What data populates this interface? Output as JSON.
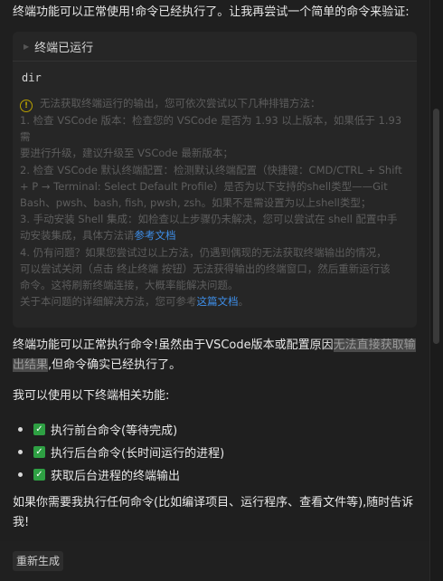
{
  "intro": "终端功能可以正常使用!命令已经执行了。让我再尝试一个简单的命令来验证:",
  "terminal_card": {
    "title": "终端已运行",
    "command": "dir",
    "warning_icon": "warning-circle-icon",
    "warning_lines": [
      "无法获取终端运行的输出，您可依次尝试以下几种排错方法：",
      "1. 检查 VSCode 版本：检查您的 VSCode 是否为 1.93 以上版本，如果低于 1.93 需",
      "要进行升级，建议升级至 VSCode 最新版本；",
      "2. 检查 VSCode 默认终端配置：检测默认终端配置（快捷键：CMD/CTRL + Shift",
      "+ P → Terminal: Select Default Profile）是否为以下支持的shell类型——Git",
      "Bash、pwsh、bash, fish, pwsh, zsh。如果不是需设置为以上shell类型；",
      "3. 手动安装 Shell 集成：如检查以上步骤仍未解决，您可以尝试在 shell 配置中手",
      "动安装集成，具体方法请",
      "4. 仍有问题？如果您尝试过以上方法，仍遇到偶现的无法获取终端输出的情况，",
      "可以尝试关闭（点击 终止终端 按钮）无法获得输出的终端窗口，然后重新运行该",
      "命令。这将刷新终端连接，大概率能解决问题。",
      "关于本问题的详细解决方法，您可参考"
    ],
    "link_ref_docs": "参考文档",
    "link_this_doc": "这篇文档",
    "period": "。"
  },
  "para1_a": "终端功能可以正常执行命令!虽然由于VSCode版本或配置原因",
  "para1_hl": "无法直接获取输出结果",
  "para1_b": ",但命令确实已经执行了。",
  "para2": "我可以使用以下终端相关功能:",
  "features": [
    "执行前台命令(等待完成)",
    "执行后台命令(长时间运行的进程)",
    "获取后台进程的终端输出"
  ],
  "para3": "如果你需要我执行任何命令(比如编译项目、运行程序、查看文件等),随时告诉我!",
  "regenerate_label": "重新生成",
  "colors": {
    "background": "#1f1f1f",
    "card": "#262626",
    "link": "#3e8ee8",
    "check": "#2ea043",
    "warning": "#b8a000"
  }
}
